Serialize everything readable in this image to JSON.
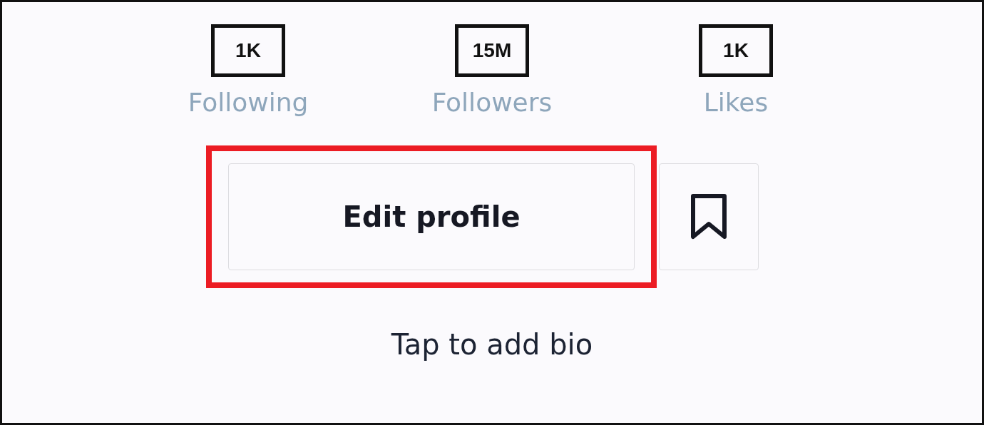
{
  "stats": [
    {
      "value": "1K",
      "label": "Following",
      "boxed": true
    },
    {
      "value": "15M",
      "label": "Followers",
      "boxed": true
    },
    {
      "value": "1K",
      "label": "Likes",
      "boxed": true
    }
  ],
  "edit_profile": {
    "label": "Edit profile",
    "highlighted": true
  },
  "bio": {
    "placeholder": "Tap to add bio"
  }
}
